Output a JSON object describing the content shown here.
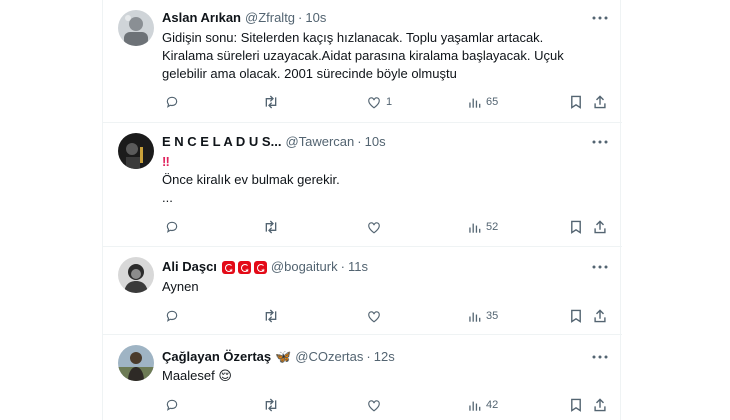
{
  "tweets": [
    {
      "name": "Aslan Arıkan",
      "handle": "@Zfraltg",
      "time": "10s",
      "lines": [
        "Gidişin sonu: Sitelerden kaçış hızlanacak. Toplu yaşamlar artacak.",
        "Kiralama süreleri uzayacak.Aidat parasına kiralama başlayacak. Uçuk",
        "gelebilir ama olacak. 2001 sürecinde böyle olmuştu"
      ],
      "likes": "1",
      "views": "65"
    },
    {
      "name": "E N C E L A D U S...",
      "handle": "@Tawercan",
      "time": "10s",
      "emoji": "‼",
      "lines": [
        "Önce kiralık ev bulmak gerekir.",
        "..."
      ],
      "likes": "",
      "views": "52"
    },
    {
      "name": "Ali Daşcı",
      "handle": "@bogaiturk",
      "time": "11s",
      "lines": [
        "Aynen"
      ],
      "likes": "",
      "views": "35"
    },
    {
      "name": "Çağlayan Özertaş",
      "badge": "🦋",
      "handle": "@COzertas",
      "time": "12s",
      "lines": [
        "Maalesef 😌"
      ],
      "likes": "",
      "views": "42"
    }
  ],
  "colors": {
    "text": "#0f1419",
    "muted": "#536471",
    "divider": "#eff3f4",
    "flag": "#e30a17"
  },
  "icons": [
    "more-icon",
    "reply-icon",
    "retweet-icon",
    "like-icon",
    "views-icon",
    "bookmark-icon",
    "share-icon"
  ]
}
